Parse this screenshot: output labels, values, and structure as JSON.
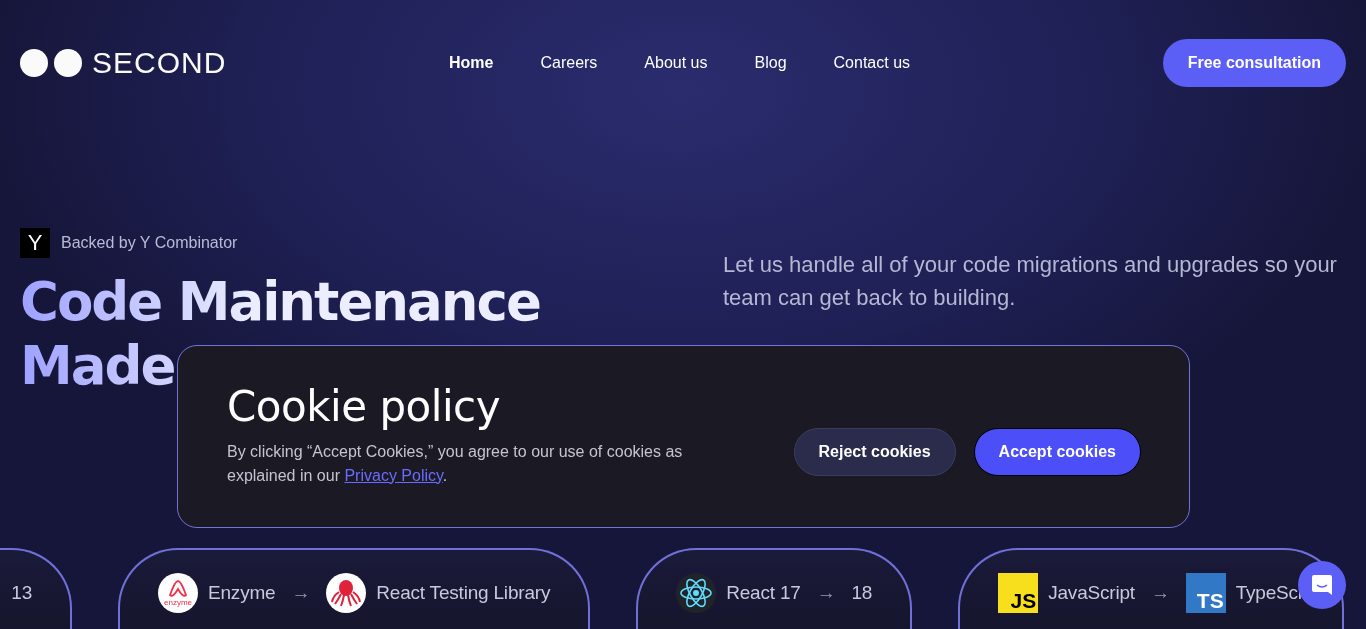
{
  "header": {
    "logo_text": "SECOND",
    "nav": [
      {
        "label": "Home",
        "selected": true
      },
      {
        "label": "Careers",
        "selected": false
      },
      {
        "label": "About us",
        "selected": false
      },
      {
        "label": "Blog",
        "selected": false
      },
      {
        "label": "Contact us",
        "selected": false
      }
    ],
    "cta": "Free consultation"
  },
  "hero": {
    "badge_logo": "Y",
    "badge_text": "Backed by Y Combinator",
    "title_lines": [
      "Code Maintenance",
      "Made"
    ],
    "subtitle": "Let us handle all of your code migrations and upgrades so your team can get back to building."
  },
  "cookie_dialog": {
    "title": "Cookie policy",
    "text": "By clicking “Accept Cookies,” you agree to our use of cookies as explained in our ",
    "link": "Privacy Policy",
    "text_end": ".",
    "buttons": [
      {
        "label": "Reject cookies",
        "kind": "secondary"
      },
      {
        "label": "Accept cookies",
        "kind": "primary"
      }
    ]
  },
  "migrations": [
    {
      "items": [
        {
          "kind": "text",
          "text": "13"
        }
      ]
    },
    {
      "items": [
        {
          "kind": "enzyme",
          "text": "enzyme"
        },
        {
          "kind": "text",
          "text": "Enzyme"
        },
        {
          "kind": "arrow",
          "text": "→"
        },
        {
          "kind": "octopus"
        },
        {
          "kind": "text",
          "text": "React Testing Library"
        }
      ]
    },
    {
      "items": [
        {
          "kind": "atom"
        },
        {
          "kind": "text",
          "text": "React 17"
        },
        {
          "kind": "arrow",
          "text": "→"
        },
        {
          "kind": "text",
          "text": "18"
        }
      ]
    },
    {
      "items": [
        {
          "kind": "js",
          "text": "JS"
        },
        {
          "kind": "text",
          "text": "JavaScript"
        },
        {
          "kind": "arrow",
          "text": "→"
        },
        {
          "kind": "ts",
          "text": "TS"
        },
        {
          "kind": "text",
          "text": "TypeScr"
        }
      ]
    }
  ]
}
